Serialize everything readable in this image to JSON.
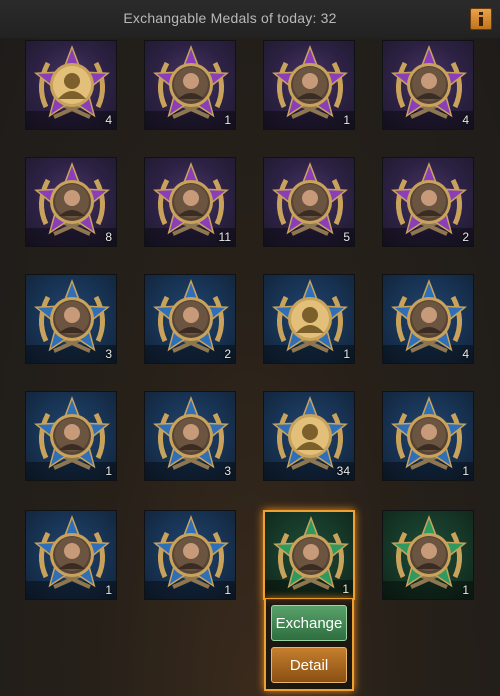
{
  "header": {
    "title": "Exchangable Medals of today:  32",
    "info_icon": "info-icon"
  },
  "tiles": [
    {
      "frame": "purple",
      "count": "4",
      "portrait": "silhouette-portrait"
    },
    {
      "frame": "purple",
      "count": "1",
      "portrait": "soldier-portrait"
    },
    {
      "frame": "purple",
      "count": "1",
      "portrait": "bearded-man-portrait"
    },
    {
      "frame": "purple",
      "count": "4",
      "portrait": "sunglasses-man-portrait"
    },
    {
      "frame": "purple",
      "count": "8",
      "portrait": "masked-cyborg-portrait"
    },
    {
      "frame": "purple",
      "count": "11",
      "portrait": "green-woman-portrait"
    },
    {
      "frame": "purple",
      "count": "5",
      "portrait": "red-haired-woman-portrait"
    },
    {
      "frame": "purple",
      "count": "2",
      "portrait": "officer-portrait"
    },
    {
      "frame": "blue",
      "count": "3",
      "portrait": "bandana-man-portrait"
    },
    {
      "frame": "blue",
      "count": "2",
      "portrait": "mustache-man-portrait"
    },
    {
      "frame": "blue",
      "count": "1",
      "portrait": "silhouette-portrait"
    },
    {
      "frame": "blue",
      "count": "4",
      "portrait": "gas-mask-portrait"
    },
    {
      "frame": "blue",
      "count": "1",
      "portrait": "bald-bandana-portrait"
    },
    {
      "frame": "blue",
      "count": "3",
      "portrait": "long-hair-man-portrait"
    },
    {
      "frame": "blue",
      "count": "34",
      "portrait": "silhouette-portrait"
    },
    {
      "frame": "blue",
      "count": "1",
      "portrait": "bearded-soldier-portrait"
    },
    {
      "frame": "blue",
      "count": "1",
      "portrait": "young-man-portrait"
    },
    {
      "frame": "blue",
      "count": "1",
      "portrait": "clown-portrait"
    },
    {
      "frame": "green",
      "count": "1",
      "portrait": "eyepatch-man-portrait",
      "selected": true
    },
    {
      "frame": "green",
      "count": "1",
      "portrait": "smiling-boy-portrait"
    }
  ],
  "popup": {
    "exchange_label": "Exchange",
    "detail_label": "Detail"
  },
  "colors": {
    "purple_star": "#8a3fb8",
    "blue_star": "#2f6fb8",
    "green_star": "#2f9a5e",
    "gold": "#c9a35b",
    "selected_border": "#f0a030",
    "exchange_button": "#3f8a52",
    "detail_button": "#a86520"
  }
}
